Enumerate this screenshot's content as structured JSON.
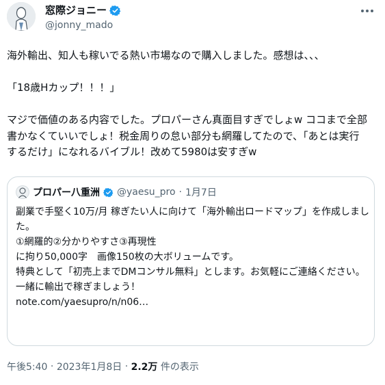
{
  "user": {
    "display_name": "窓際ジョニー",
    "handle": "@jonny_mado",
    "avatar_icon": "avatar-illustration-icon",
    "verified_icon": "verified-badge-icon",
    "verified_color": "#1d9bf0"
  },
  "tweet": {
    "text": "海外輸出、知人も稼いでる熱い市場なので購入しました。感想は、、、\n\n「18歳Hカップ！！！」\n\nマジで価値のある内容でした。プロパーさん真面目すぎでしょw ココまで全部書かなくていいでしょ！税金周りの怠い部分も網羅してたので、「あとは実行するだけ」になれるバイブル！改めて5980は安すぎw"
  },
  "quote": {
    "display_name": "プロパー八重洲",
    "handle": "@yaesu_pro",
    "dot": "·",
    "date": "1月7日",
    "text": "副業で手堅く10万/月 稼ぎたい人に向けて「海外輸出ロードマップ」を作成しました。\n①網羅的②分かりやすさ③再現性\nに拘り50,000字　画像150枚の大ボリュームです。\n特典として「初売上までDMコンサル無料」とします。お気軽にご連絡ください。\n一緒に輸出で稼ぎましょう！\nnote.com/yaesupro/n/n06…"
  },
  "meta": {
    "time": "午後5:40",
    "sep1": " · ",
    "date": "2023年1月8日",
    "sep2": " · ",
    "views": "2.2万",
    "views_label": " 件の表示"
  },
  "more_icon": "more-options-icon"
}
